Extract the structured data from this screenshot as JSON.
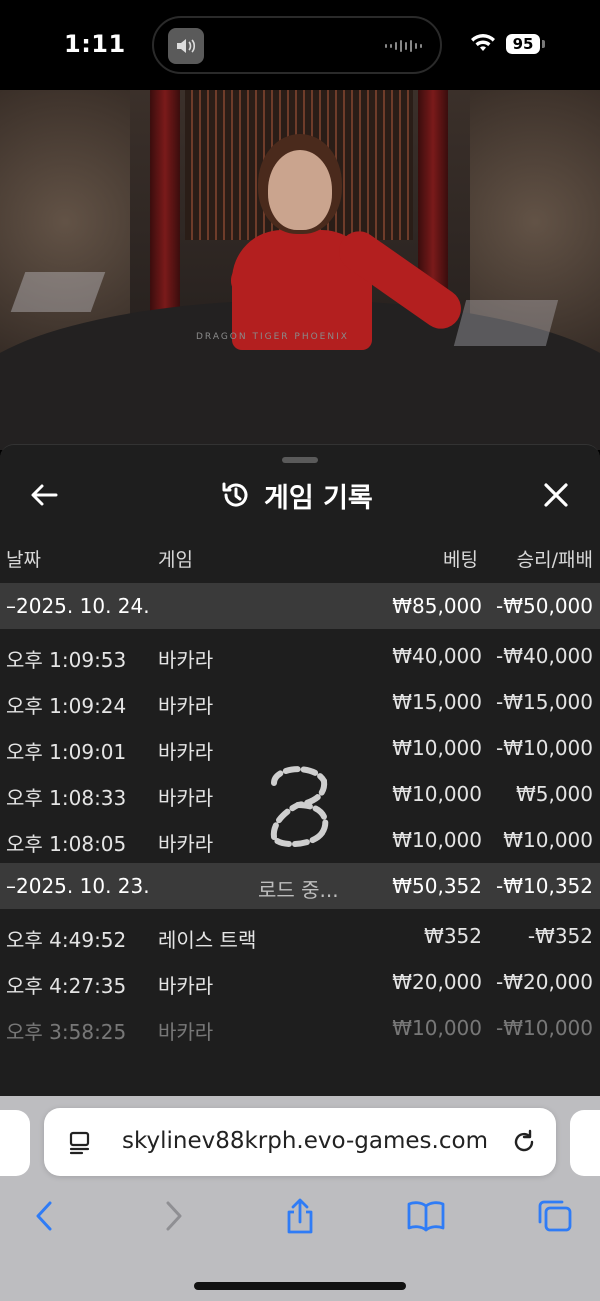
{
  "status_bar": {
    "time": "1:11",
    "battery": "95"
  },
  "video": {
    "table_text": "DRAGON   TIGER   PHOENIX"
  },
  "panel": {
    "title": "게임 기록",
    "columns": {
      "date": "날짜",
      "game": "게임",
      "bet": "베팅",
      "win_loss": "승리/패배"
    },
    "loading_text": "로드 중...",
    "groups": [
      {
        "date": "–2025. 10. 24.",
        "bet": "₩85,000",
        "win_loss": "-₩50,000",
        "rows": [
          {
            "time": "오후 1:09:53",
            "game": "바카라",
            "bet": "₩40,000",
            "win_loss": "-₩40,000"
          },
          {
            "time": "오후 1:09:24",
            "game": "바카라",
            "bet": "₩15,000",
            "win_loss": "-₩15,000"
          },
          {
            "time": "오후 1:09:01",
            "game": "바카라",
            "bet": "₩10,000",
            "win_loss": "-₩10,000"
          },
          {
            "time": "오후 1:08:33",
            "game": "바카라",
            "bet": "₩10,000",
            "win_loss": "₩5,000"
          },
          {
            "time": "오후 1:08:05",
            "game": "바카라",
            "bet": "₩10,000",
            "win_loss": "₩10,000"
          }
        ]
      },
      {
        "date": "–2025. 10. 23.",
        "bet": "₩50,352",
        "win_loss": "-₩10,352",
        "rows": [
          {
            "time": "오후 4:49:52",
            "game": "레이스 트랙",
            "bet": "₩352",
            "win_loss": "-₩352"
          },
          {
            "time": "오후 4:27:35",
            "game": "바카라",
            "bet": "₩20,000",
            "win_loss": "-₩20,000"
          },
          {
            "time": "오후 3:58:25",
            "game": "바카라",
            "bet": "₩10,000",
            "win_loss": "-₩10,000"
          }
        ]
      }
    ]
  },
  "browser": {
    "url": "skylinev88krph.evo-games.com",
    "accent_color": "#2f7cf6"
  }
}
